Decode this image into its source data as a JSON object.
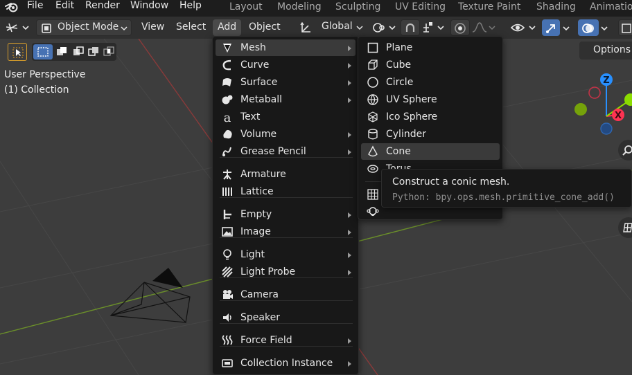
{
  "topbar": {
    "menus": [
      "File",
      "Edit",
      "Render",
      "Window",
      "Help"
    ],
    "workspaces": [
      "Layout",
      "Modeling",
      "Sculpting",
      "UV Editing",
      "Texture Paint",
      "Shading",
      "Animation"
    ]
  },
  "header": {
    "mode": "Object Mode",
    "menus": [
      "View",
      "Select",
      "Add",
      "Object"
    ],
    "orientation": "Global",
    "options": "Options"
  },
  "viewport": {
    "perspective": "User Perspective",
    "collection": "(1) Collection",
    "gizmo": {
      "z": "Z",
      "x": "X"
    }
  },
  "add_menu": {
    "items": [
      {
        "label": "Mesh",
        "icon": "mesh-cone-icon",
        "submenu": true
      },
      {
        "label": "Curve",
        "icon": "curve-icon",
        "submenu": true
      },
      {
        "label": "Surface",
        "icon": "surface-icon",
        "submenu": true
      },
      {
        "label": "Metaball",
        "icon": "metaball-icon",
        "submenu": true
      },
      {
        "label": "Text",
        "icon": "text-icon",
        "submenu": false
      },
      {
        "label": "Volume",
        "icon": "volume-icon",
        "submenu": true
      },
      {
        "label": "Grease Pencil",
        "icon": "grease-pencil-icon",
        "submenu": true
      },
      {
        "label": "Armature",
        "icon": "armature-icon",
        "submenu": false
      },
      {
        "label": "Lattice",
        "icon": "lattice-icon",
        "submenu": false
      },
      {
        "label": "Empty",
        "icon": "empty-icon",
        "submenu": true
      },
      {
        "label": "Image",
        "icon": "image-icon",
        "submenu": true
      },
      {
        "label": "Light",
        "icon": "light-icon",
        "submenu": true
      },
      {
        "label": "Light Probe",
        "icon": "light-probe-icon",
        "submenu": true
      },
      {
        "label": "Camera",
        "icon": "camera-icon",
        "submenu": false
      },
      {
        "label": "Speaker",
        "icon": "speaker-icon",
        "submenu": false
      },
      {
        "label": "Force Field",
        "icon": "force-field-icon",
        "submenu": true
      },
      {
        "label": "Collection Instance",
        "icon": "collection-instance-icon",
        "submenu": true
      }
    ]
  },
  "mesh_menu": {
    "items": [
      {
        "label": "Plane",
        "icon": "plane-icon"
      },
      {
        "label": "Cube",
        "icon": "cube-icon"
      },
      {
        "label": "Circle",
        "icon": "circle-icon"
      },
      {
        "label": "UV Sphere",
        "icon": "uv-sphere-icon"
      },
      {
        "label": "Ico Sphere",
        "icon": "ico-sphere-icon"
      },
      {
        "label": "Cylinder",
        "icon": "cylinder-icon"
      },
      {
        "label": "Cone",
        "icon": "cone-icon"
      },
      {
        "label": "Torus",
        "icon": "torus-icon"
      }
    ],
    "highlighted": "Cone"
  },
  "tooltip": {
    "description": "Construct a conic mesh.",
    "python": "Python: bpy.ops.mesh.primitive_cone_add()"
  },
  "colors": {
    "accent": "#4772b3",
    "axis_x": "#ff3352",
    "axis_y": "#8bdc00",
    "axis_z": "#2890ff"
  }
}
